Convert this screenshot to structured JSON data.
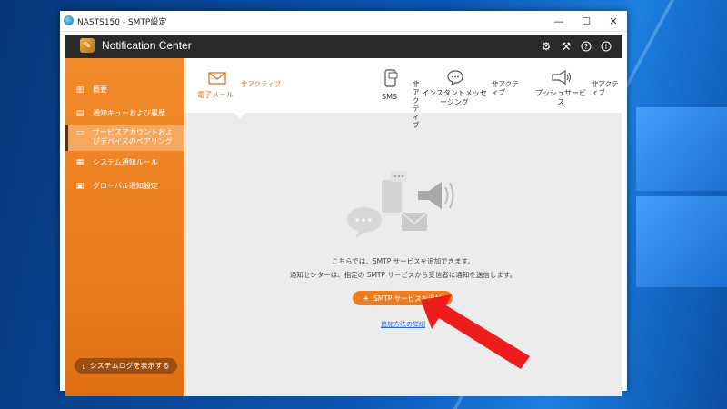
{
  "window": {
    "title": "NASTS150 - SMTP設定",
    "controls": {
      "minimize": "—",
      "maximize": "☐",
      "close": "✕"
    }
  },
  "header": {
    "app_title": "Notification Center",
    "icons": [
      "gear-icon",
      "tools-icon",
      "help-icon",
      "info-icon"
    ]
  },
  "sidebar": {
    "items": [
      {
        "label": "概要",
        "icon": "chart-icon",
        "active": false
      },
      {
        "label": "通知キューおよび履歴",
        "icon": "queue-icon",
        "active": false
      },
      {
        "label": "サービスアカウントおよびデバイスのペアリング",
        "icon": "devices-icon",
        "active": true
      },
      {
        "label": "システム通知ルール",
        "icon": "rules-icon",
        "active": false
      },
      {
        "label": "グローバル通知設定",
        "icon": "global-settings-icon",
        "active": false
      }
    ],
    "syslog_button": "システムログを表示する"
  },
  "tabs": [
    {
      "label": "電子メール",
      "status": "非アクティブ",
      "icon": "mail-icon",
      "active": true
    },
    {
      "label": "SMS",
      "status": "非アクティブ",
      "icon": "phone-icon",
      "active": false
    },
    {
      "label": "インスタントメッセージング",
      "status": "非アクティブ",
      "icon": "chat-icon",
      "active": false
    },
    {
      "label": "プッシュサービス",
      "status": "非アクティブ",
      "icon": "megaphone-icon",
      "active": false
    }
  ],
  "main": {
    "message_line1": "こちらでは、SMTP サービスを追加できます。",
    "message_line2": "通知センターは、指定の SMTP サービスから受信者に通知を送信します。",
    "add_button": "SMTP サービスを追加",
    "learn_link": "追加方法の詳細"
  },
  "colors": {
    "accent": "#ee7d22",
    "sidebar": "#ec7d1f",
    "header": "#2a2a2a",
    "link": "#2a66c7",
    "annotation_arrow": "#ee1c1c"
  }
}
